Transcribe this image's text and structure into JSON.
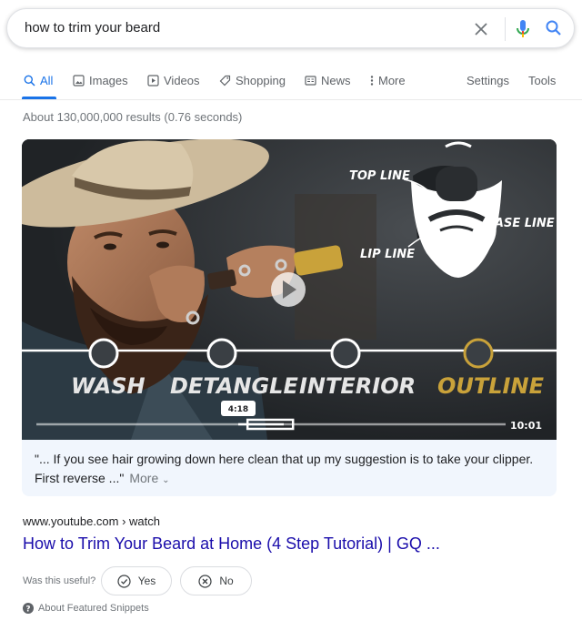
{
  "search": {
    "query": "how to trim your beard"
  },
  "tabs": [
    {
      "label": "All",
      "icon": "search-icon"
    },
    {
      "label": "Images",
      "icon": "image-icon"
    },
    {
      "label": "Videos",
      "icon": "play-icon"
    },
    {
      "label": "Shopping",
      "icon": "tag-icon"
    },
    {
      "label": "News",
      "icon": "news-icon"
    },
    {
      "label": "More",
      "icon": "more-vert-icon"
    },
    {
      "label": "Settings"
    },
    {
      "label": "Tools"
    }
  ],
  "result_stats": "About 130,000,000 results (0.76 seconds)",
  "video": {
    "overlay_labels": {
      "top_line": "TOP LINE",
      "base_line": "BASE LINE",
      "lip_line": "LIP LINE"
    },
    "steps": [
      "WASH",
      "DETANGLE",
      "INTERIOR",
      "OUTLINE"
    ],
    "timestamp": "4:18",
    "duration": "10:01",
    "progress": 0.45,
    "caption": "\"... If you see hair growing down here clean that up my suggestion is to take your clipper. First reverse ...\"",
    "more_label": "More"
  },
  "result": {
    "url": "www.youtube.com › watch",
    "title": "How to Trim Your Beard at Home (4 Step Tutorial) | GQ ..."
  },
  "feedback": {
    "question": "Was this useful?",
    "yes": "Yes",
    "no": "No"
  },
  "about": "About Featured Snippets",
  "colors": {
    "accent": "#1a73e8",
    "link": "#1a0dab",
    "outline_step": "#c9a23a"
  }
}
